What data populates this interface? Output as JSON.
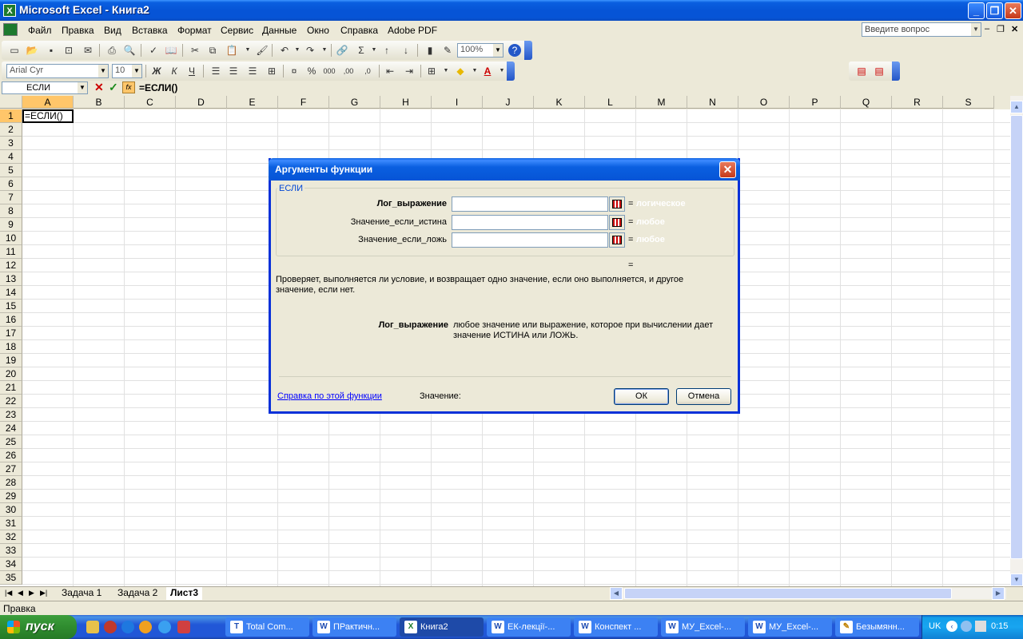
{
  "window": {
    "title": "Microsoft Excel - Книга2",
    "app_icon": "X"
  },
  "menu": {
    "items": [
      "Файл",
      "Правка",
      "Вид",
      "Вставка",
      "Формат",
      "Сервис",
      "Данные",
      "Окно",
      "Справка",
      "Adobe PDF"
    ],
    "ask_placeholder": "Введите вопрос"
  },
  "toolbar": {
    "zoom": "100%",
    "font": "Arial Cyr",
    "size": "10",
    "bold": "Ж",
    "italic": "К",
    "underline": "Ч"
  },
  "formula_bar": {
    "name_box": "ЕСЛИ",
    "fx": "fx",
    "formula": "=ЕСЛИ()"
  },
  "grid": {
    "columns": [
      "A",
      "B",
      "C",
      "D",
      "E",
      "F",
      "G",
      "H",
      "I",
      "J",
      "K",
      "L",
      "M",
      "N",
      "O",
      "P",
      "Q",
      "R",
      "S"
    ],
    "rows": [
      "1",
      "2",
      "3",
      "4",
      "5",
      "6",
      "7",
      "8",
      "9",
      "10",
      "11",
      "12",
      "13",
      "14",
      "15",
      "16",
      "17",
      "18",
      "19",
      "20",
      "21",
      "22",
      "23",
      "24",
      "25",
      "26",
      "27",
      "28",
      "29",
      "30",
      "31",
      "32",
      "33",
      "34",
      "35"
    ],
    "cell_a1": "=ЕСЛИ()"
  },
  "sheets": {
    "tabs": [
      "Задача 1",
      "Задача 2",
      "Лист3"
    ],
    "active": "Лист3"
  },
  "status": {
    "text": "Правка"
  },
  "dialog": {
    "title": "Аргументы функции",
    "group": "ЕСЛИ",
    "args": [
      {
        "label": "Лог_выражение",
        "type": "логическое"
      },
      {
        "label": "Значение_если_истина",
        "type": "любое"
      },
      {
        "label": "Значение_если_ложь",
        "type": "любое"
      }
    ],
    "eq": "=",
    "description": "Проверяет, выполняется ли условие, и возвращает одно значение, если оно выполняется, и другое значение, если нет.",
    "arg_name": "Лог_выражение",
    "arg_desc": "любое значение или выражение, которое при вычислении дает значение ИСТИНА или ЛОЖЬ.",
    "help_link": "Справка по этой функции",
    "value_label": "Значение:",
    "ok": "ОК",
    "cancel": "Отмена"
  },
  "taskbar": {
    "start": "пуск",
    "tasks": [
      "Total Com...",
      "ПРактичн...",
      "Книга2",
      "ЕК-лекції-...",
      "Конспект ...",
      "МУ_Excel-...",
      "МУ_Excel-...",
      "Безымянн..."
    ],
    "active": "Книга2",
    "lang": "UK",
    "clock": "0:15"
  }
}
